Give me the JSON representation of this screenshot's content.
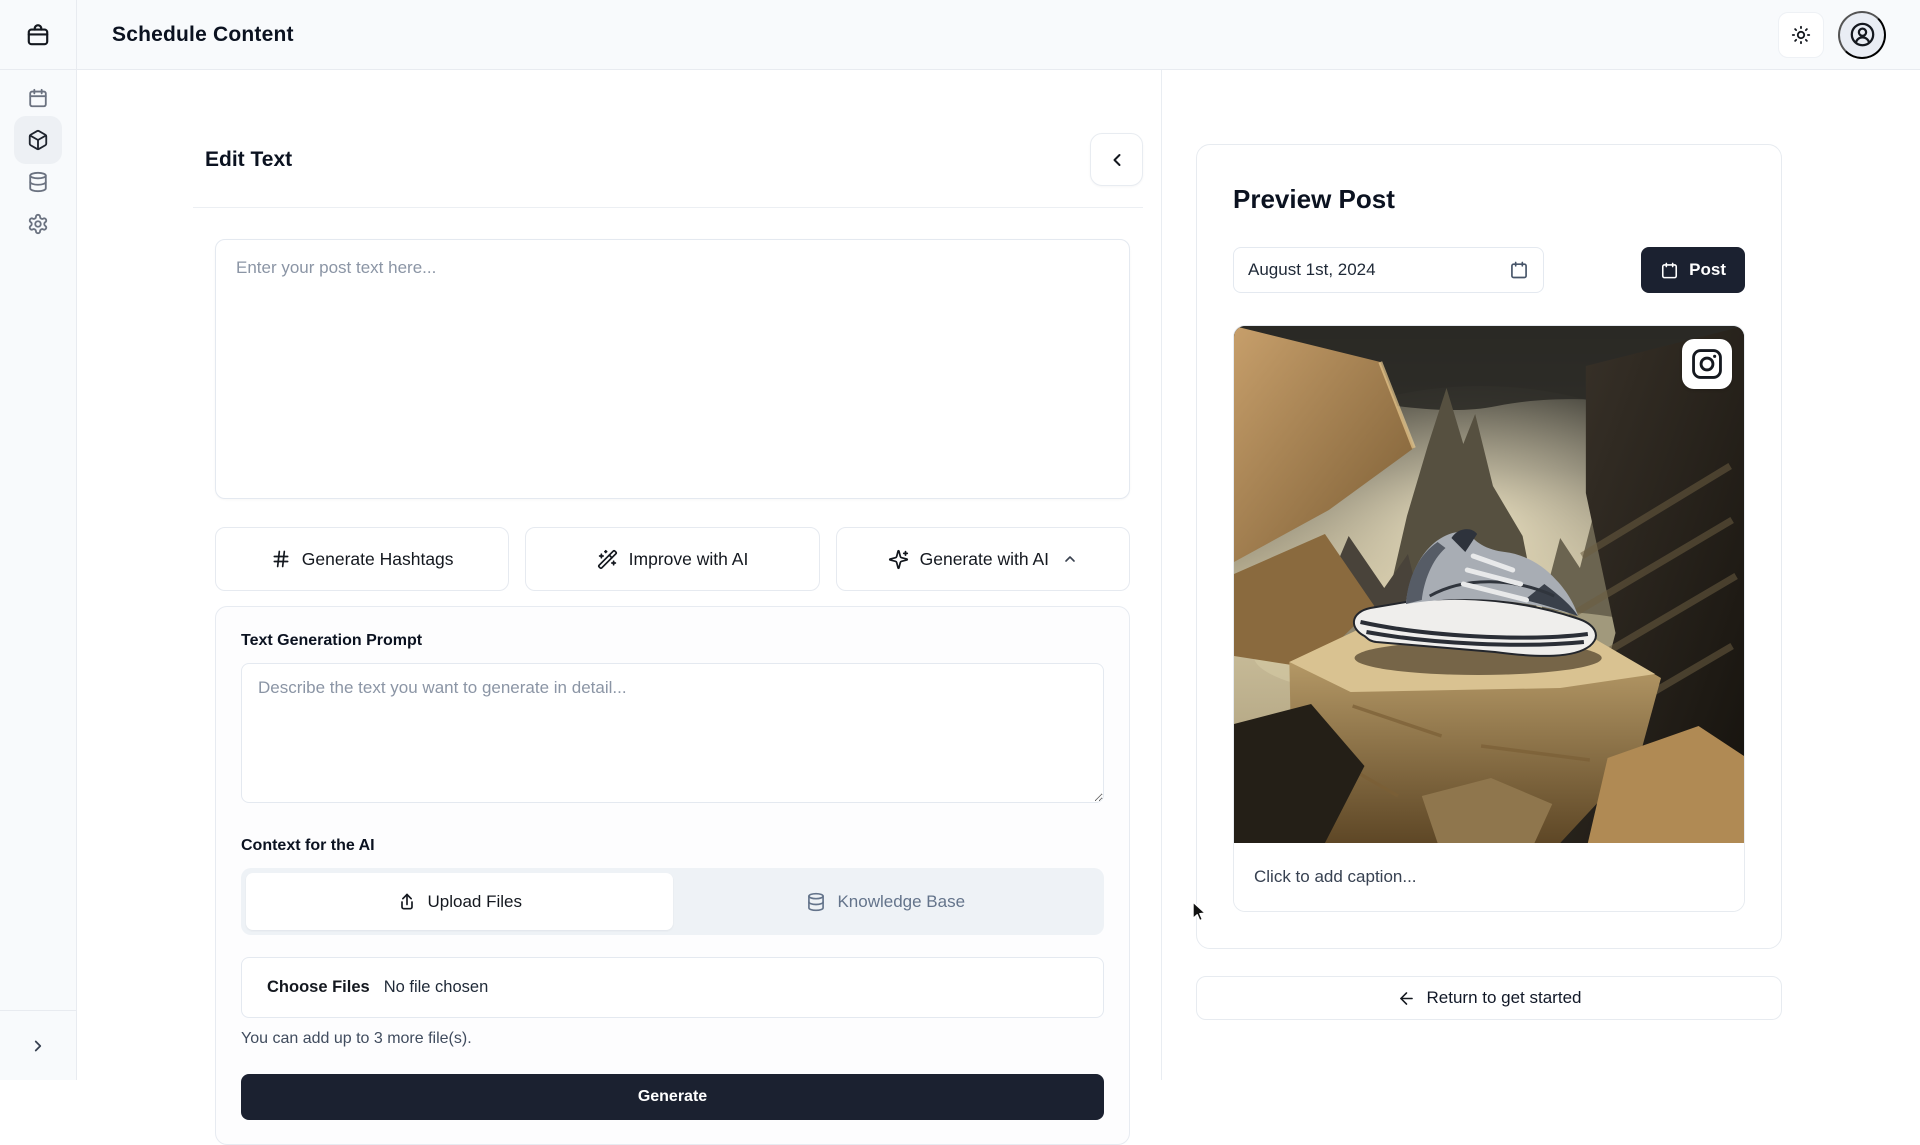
{
  "topbar": {
    "title": "Schedule Content",
    "logo_icon": "briefcase-icon",
    "theme_toggle_icon": "sun-icon",
    "account_icon": "user-circle-icon"
  },
  "sidebar": {
    "items": [
      {
        "id": "calendar",
        "icon": "calendar-icon",
        "active": false
      },
      {
        "id": "content",
        "icon": "package-icon",
        "active": true
      },
      {
        "id": "database",
        "icon": "database-icon",
        "active": false
      },
      {
        "id": "settings",
        "icon": "gear-icon",
        "active": false
      }
    ],
    "collapse_icon": "chevron-right-icon"
  },
  "editor": {
    "title": "Edit Text",
    "back_icon": "chevron-left-icon",
    "post_text": {
      "value": "",
      "placeholder": "Enter your post text here..."
    },
    "actions": [
      {
        "label": "Generate Hashtags",
        "icon": "hash-icon"
      },
      {
        "label": "Improve with AI",
        "icon": "wand-sparkles-icon"
      },
      {
        "label": "Generate with AI",
        "icon": "sparkles-icon",
        "chevron": "up"
      }
    ],
    "generation_panel": {
      "prompt_label": "Text Generation Prompt",
      "prompt": {
        "value": "",
        "placeholder": "Describe the text you want to generate in detail..."
      },
      "context_label": "Context for the AI",
      "tabs": [
        {
          "label": "Upload Files",
          "icon": "upload-icon",
          "active": true
        },
        {
          "label": "Knowledge Base",
          "icon": "database-icon",
          "active": false
        }
      ],
      "file_input": {
        "button_label": "Choose Files",
        "status_text": "No file chosen"
      },
      "helper_text": "You can add up to 3 more file(s).",
      "generate_label": "Generate"
    }
  },
  "preview": {
    "title": "Preview Post",
    "schedule_date": {
      "value": "August 1st, 2024",
      "icon": "calendar-icon"
    },
    "post_button": {
      "label": "Post",
      "icon": "calendar-icon"
    },
    "platform_badge_icon": "instagram-icon",
    "image_description": "Gray sneaker on a rock pedestal in a dramatic rocky canyon",
    "caption": {
      "placeholder": "Click to add caption..."
    },
    "return_button": {
      "label": "Return to get started",
      "icon": "arrow-left-icon"
    }
  },
  "colors": {
    "topbar_bg": "#f8fafc",
    "border": "#e7ebf0",
    "primary_dark": "#1b2130",
    "muted_text": "#64748b",
    "tab_bg": "#eef2f6"
  }
}
